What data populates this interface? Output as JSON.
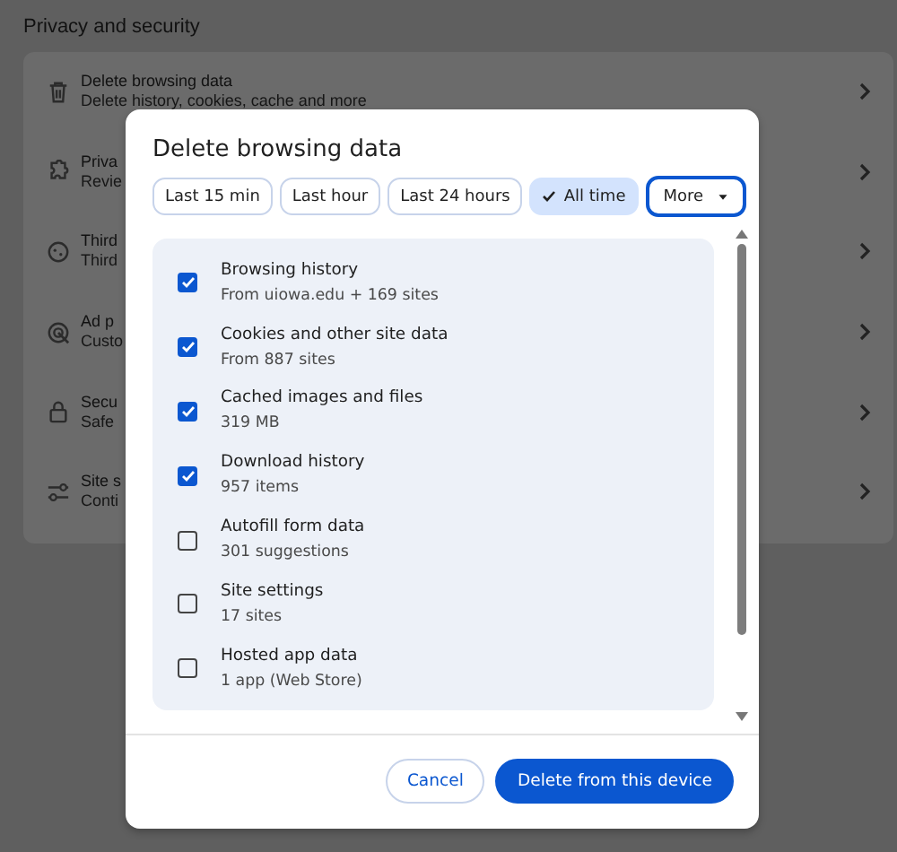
{
  "page": {
    "section_title": "Privacy and security",
    "rows": [
      {
        "title": "Delete browsing data",
        "subtitle": "Delete history, cookies, cache and more"
      },
      {
        "title": "Priva",
        "subtitle": "Revie"
      },
      {
        "title": "Third",
        "subtitle": "Third"
      },
      {
        "title": "Ad p",
        "subtitle": "Custo"
      },
      {
        "title": "Secu",
        "subtitle": "Safe"
      },
      {
        "title": "Site s",
        "subtitle": "Conti"
      }
    ]
  },
  "dialog": {
    "title": "Delete browsing data",
    "time_ranges": [
      {
        "label": "Last 15 min",
        "selected": false,
        "kind": "chip"
      },
      {
        "label": "Last hour",
        "selected": false,
        "kind": "chip"
      },
      {
        "label": "Last 24 hours",
        "selected": false,
        "kind": "chip"
      },
      {
        "label": "All time",
        "selected": true,
        "kind": "chip"
      },
      {
        "label": "More",
        "selected": false,
        "kind": "dropdown"
      }
    ],
    "items": [
      {
        "title": "Browsing history",
        "subtitle": "From uiowa.edu + 169 sites",
        "checked": true
      },
      {
        "title": "Cookies and other site data",
        "subtitle": "From 887 sites",
        "checked": true
      },
      {
        "title": "Cached images and files",
        "subtitle": "319 MB",
        "checked": true
      },
      {
        "title": "Download history",
        "subtitle": "957 items",
        "checked": true
      },
      {
        "title": "Autofill form data",
        "subtitle": "301 suggestions",
        "checked": false
      },
      {
        "title": "Site settings",
        "subtitle": "17 sites",
        "checked": false
      },
      {
        "title": "Hosted app data",
        "subtitle": "1 app (Web Store)",
        "checked": false
      }
    ],
    "buttons": [
      {
        "label": "Cancel",
        "kind": "secondary"
      },
      {
        "label": "Delete from this device",
        "kind": "primary"
      }
    ]
  }
}
